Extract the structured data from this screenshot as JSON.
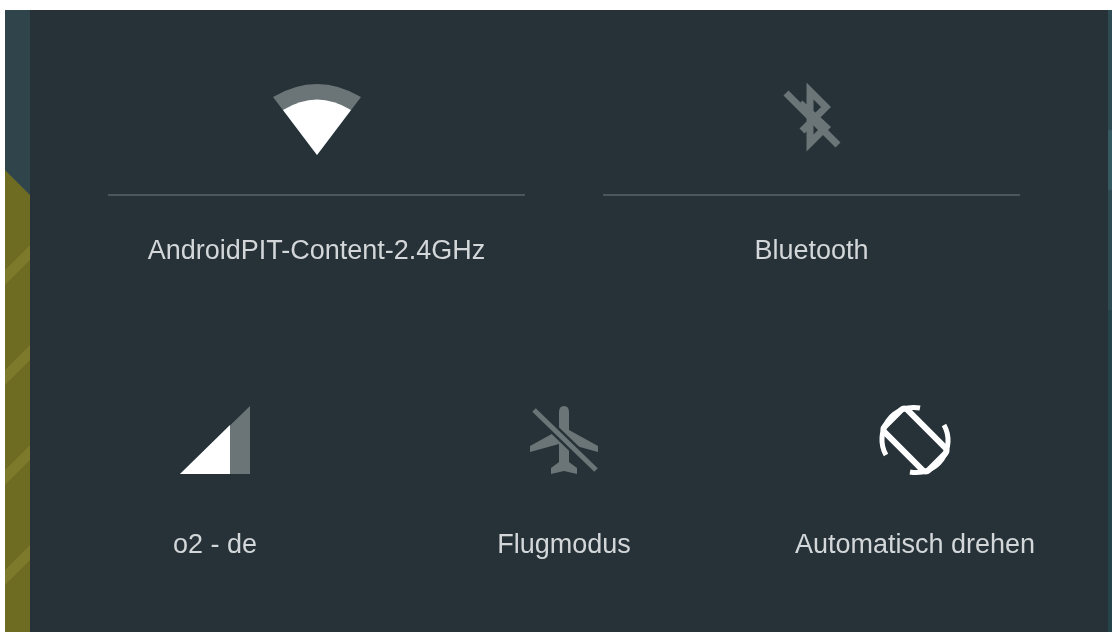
{
  "quick_settings": {
    "rows": [
      {
        "divided": true,
        "tiles": [
          {
            "kind": "wifi",
            "label": "AndroidPIT-Content-2.4GHz",
            "on": true
          },
          {
            "kind": "bluetooth",
            "label": "Bluetooth",
            "on": false
          }
        ]
      },
      {
        "divided": false,
        "tiles": [
          {
            "kind": "cellular",
            "label": "o2 - de",
            "on": true
          },
          {
            "kind": "airplane",
            "label": "Flugmodus",
            "on": false
          },
          {
            "kind": "rotation",
            "label": "Automatisch drehen",
            "on": true
          }
        ]
      }
    ]
  }
}
